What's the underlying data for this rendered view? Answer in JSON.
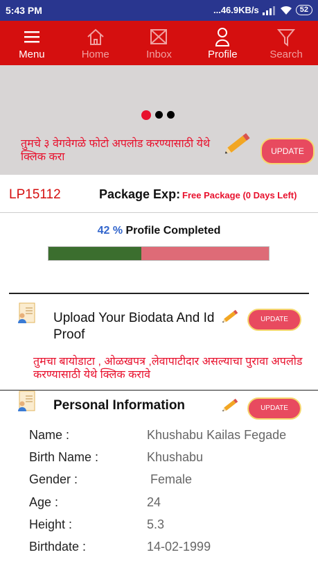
{
  "status_bar": {
    "time": "5:43 PM",
    "speed": "...46.9KB/s",
    "battery": "52"
  },
  "nav": [
    {
      "label": "Menu",
      "icon": "menu-icon"
    },
    {
      "label": "Home",
      "icon": "home-icon"
    },
    {
      "label": "Inbox",
      "icon": "inbox-icon"
    },
    {
      "label": "Profile",
      "icon": "profile-icon"
    },
    {
      "label": "Search",
      "icon": "filter-icon"
    }
  ],
  "photo": {
    "upload_text": "तुमचे ३ वेगवेगळे फोटो अपलोड करण्यासाठी येथे क्लिक करा",
    "update_label": "UPDATE",
    "carousel_count": 3,
    "carousel_active": 0
  },
  "profile": {
    "id": "LP15112",
    "package_label": "Package Exp:",
    "package_value": "Free Package (0 Days Left)",
    "percent_text": "42 %",
    "completed_label": "Profile Completed",
    "completion_fraction": 0.42
  },
  "biodata": {
    "title": "Upload Your Biodata And Id Proof",
    "update_label": "UPDATE",
    "desc": "तुमचा बायोडाटा , ओळखपत्र ,लेवापाटीदार असल्याचा पुरावा अपलोड करण्यासाठी येथे क्लिक करावे"
  },
  "personal": {
    "title": "Personal Information",
    "update_label": "UPDATE",
    "fields": [
      {
        "label": "Name :",
        "value": "Khushabu Kailas Fegade"
      },
      {
        "label": "Birth Name :",
        "value": "Khushabu"
      },
      {
        "label": "Gender :",
        "value": " Female"
      },
      {
        "label": "Age :",
        "value": "24"
      },
      {
        "label": "Height :",
        "value": "5.3"
      },
      {
        "label": "Birthdate :",
        "value": "14-02-1999"
      }
    ]
  },
  "colors": {
    "accent": "#d50f0f",
    "statusbar": "#29368f",
    "progress_done": "#3b6e2e",
    "progress_rest": "#de6b77",
    "link_red": "#e8112d"
  }
}
